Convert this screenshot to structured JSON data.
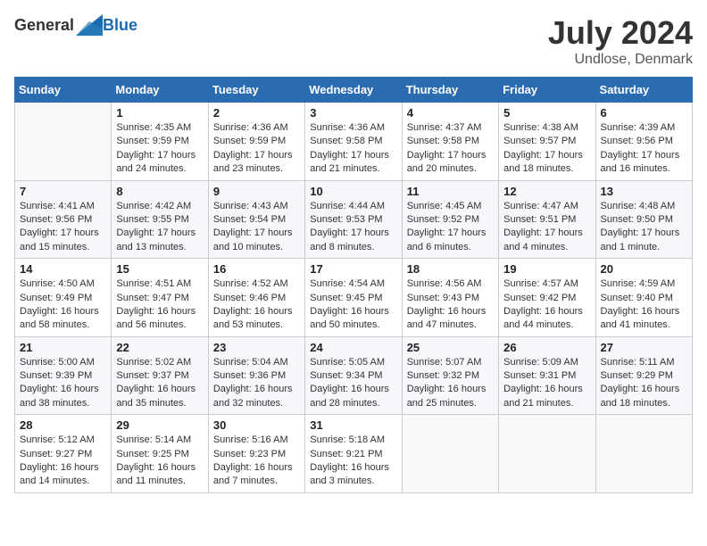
{
  "logo": {
    "general": "General",
    "blue": "Blue"
  },
  "title": "July 2024",
  "location": "Undlose, Denmark",
  "headers": [
    "Sunday",
    "Monday",
    "Tuesday",
    "Wednesday",
    "Thursday",
    "Friday",
    "Saturday"
  ],
  "weeks": [
    [
      {
        "day": "",
        "sunrise": "",
        "sunset": "",
        "daylight": ""
      },
      {
        "day": "1",
        "sunrise": "Sunrise: 4:35 AM",
        "sunset": "Sunset: 9:59 PM",
        "daylight": "Daylight: 17 hours and 24 minutes."
      },
      {
        "day": "2",
        "sunrise": "Sunrise: 4:36 AM",
        "sunset": "Sunset: 9:59 PM",
        "daylight": "Daylight: 17 hours and 23 minutes."
      },
      {
        "day": "3",
        "sunrise": "Sunrise: 4:36 AM",
        "sunset": "Sunset: 9:58 PM",
        "daylight": "Daylight: 17 hours and 21 minutes."
      },
      {
        "day": "4",
        "sunrise": "Sunrise: 4:37 AM",
        "sunset": "Sunset: 9:58 PM",
        "daylight": "Daylight: 17 hours and 20 minutes."
      },
      {
        "day": "5",
        "sunrise": "Sunrise: 4:38 AM",
        "sunset": "Sunset: 9:57 PM",
        "daylight": "Daylight: 17 hours and 18 minutes."
      },
      {
        "day": "6",
        "sunrise": "Sunrise: 4:39 AM",
        "sunset": "Sunset: 9:56 PM",
        "daylight": "Daylight: 17 hours and 16 minutes."
      }
    ],
    [
      {
        "day": "7",
        "sunrise": "Sunrise: 4:41 AM",
        "sunset": "Sunset: 9:56 PM",
        "daylight": "Daylight: 17 hours and 15 minutes."
      },
      {
        "day": "8",
        "sunrise": "Sunrise: 4:42 AM",
        "sunset": "Sunset: 9:55 PM",
        "daylight": "Daylight: 17 hours and 13 minutes."
      },
      {
        "day": "9",
        "sunrise": "Sunrise: 4:43 AM",
        "sunset": "Sunset: 9:54 PM",
        "daylight": "Daylight: 17 hours and 10 minutes."
      },
      {
        "day": "10",
        "sunrise": "Sunrise: 4:44 AM",
        "sunset": "Sunset: 9:53 PM",
        "daylight": "Daylight: 17 hours and 8 minutes."
      },
      {
        "day": "11",
        "sunrise": "Sunrise: 4:45 AM",
        "sunset": "Sunset: 9:52 PM",
        "daylight": "Daylight: 17 hours and 6 minutes."
      },
      {
        "day": "12",
        "sunrise": "Sunrise: 4:47 AM",
        "sunset": "Sunset: 9:51 PM",
        "daylight": "Daylight: 17 hours and 4 minutes."
      },
      {
        "day": "13",
        "sunrise": "Sunrise: 4:48 AM",
        "sunset": "Sunset: 9:50 PM",
        "daylight": "Daylight: 17 hours and 1 minute."
      }
    ],
    [
      {
        "day": "14",
        "sunrise": "Sunrise: 4:50 AM",
        "sunset": "Sunset: 9:49 PM",
        "daylight": "Daylight: 16 hours and 58 minutes."
      },
      {
        "day": "15",
        "sunrise": "Sunrise: 4:51 AM",
        "sunset": "Sunset: 9:47 PM",
        "daylight": "Daylight: 16 hours and 56 minutes."
      },
      {
        "day": "16",
        "sunrise": "Sunrise: 4:52 AM",
        "sunset": "Sunset: 9:46 PM",
        "daylight": "Daylight: 16 hours and 53 minutes."
      },
      {
        "day": "17",
        "sunrise": "Sunrise: 4:54 AM",
        "sunset": "Sunset: 9:45 PM",
        "daylight": "Daylight: 16 hours and 50 minutes."
      },
      {
        "day": "18",
        "sunrise": "Sunrise: 4:56 AM",
        "sunset": "Sunset: 9:43 PM",
        "daylight": "Daylight: 16 hours and 47 minutes."
      },
      {
        "day": "19",
        "sunrise": "Sunrise: 4:57 AM",
        "sunset": "Sunset: 9:42 PM",
        "daylight": "Daylight: 16 hours and 44 minutes."
      },
      {
        "day": "20",
        "sunrise": "Sunrise: 4:59 AM",
        "sunset": "Sunset: 9:40 PM",
        "daylight": "Daylight: 16 hours and 41 minutes."
      }
    ],
    [
      {
        "day": "21",
        "sunrise": "Sunrise: 5:00 AM",
        "sunset": "Sunset: 9:39 PM",
        "daylight": "Daylight: 16 hours and 38 minutes."
      },
      {
        "day": "22",
        "sunrise": "Sunrise: 5:02 AM",
        "sunset": "Sunset: 9:37 PM",
        "daylight": "Daylight: 16 hours and 35 minutes."
      },
      {
        "day": "23",
        "sunrise": "Sunrise: 5:04 AM",
        "sunset": "Sunset: 9:36 PM",
        "daylight": "Daylight: 16 hours and 32 minutes."
      },
      {
        "day": "24",
        "sunrise": "Sunrise: 5:05 AM",
        "sunset": "Sunset: 9:34 PM",
        "daylight": "Daylight: 16 hours and 28 minutes."
      },
      {
        "day": "25",
        "sunrise": "Sunrise: 5:07 AM",
        "sunset": "Sunset: 9:32 PM",
        "daylight": "Daylight: 16 hours and 25 minutes."
      },
      {
        "day": "26",
        "sunrise": "Sunrise: 5:09 AM",
        "sunset": "Sunset: 9:31 PM",
        "daylight": "Daylight: 16 hours and 21 minutes."
      },
      {
        "day": "27",
        "sunrise": "Sunrise: 5:11 AM",
        "sunset": "Sunset: 9:29 PM",
        "daylight": "Daylight: 16 hours and 18 minutes."
      }
    ],
    [
      {
        "day": "28",
        "sunrise": "Sunrise: 5:12 AM",
        "sunset": "Sunset: 9:27 PM",
        "daylight": "Daylight: 16 hours and 14 minutes."
      },
      {
        "day": "29",
        "sunrise": "Sunrise: 5:14 AM",
        "sunset": "Sunset: 9:25 PM",
        "daylight": "Daylight: 16 hours and 11 minutes."
      },
      {
        "day": "30",
        "sunrise": "Sunrise: 5:16 AM",
        "sunset": "Sunset: 9:23 PM",
        "daylight": "Daylight: 16 hours and 7 minutes."
      },
      {
        "day": "31",
        "sunrise": "Sunrise: 5:18 AM",
        "sunset": "Sunset: 9:21 PM",
        "daylight": "Daylight: 16 hours and 3 minutes."
      },
      {
        "day": "",
        "sunrise": "",
        "sunset": "",
        "daylight": ""
      },
      {
        "day": "",
        "sunrise": "",
        "sunset": "",
        "daylight": ""
      },
      {
        "day": "",
        "sunrise": "",
        "sunset": "",
        "daylight": ""
      }
    ]
  ]
}
